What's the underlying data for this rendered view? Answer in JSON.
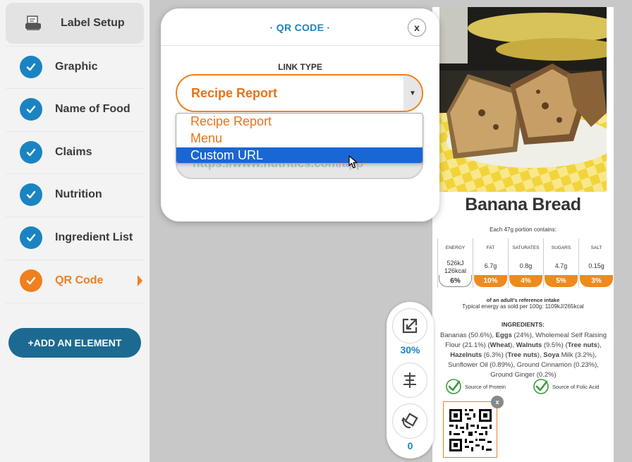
{
  "sidebar": {
    "items": [
      {
        "label": "Label Setup",
        "icon": "printer-icon"
      },
      {
        "label": "Graphic",
        "icon": "check-icon"
      },
      {
        "label": "Name of Food",
        "icon": "check-icon"
      },
      {
        "label": "Claims",
        "icon": "check-icon"
      },
      {
        "label": "Nutrition",
        "icon": "check-icon"
      },
      {
        "label": "Ingredient List",
        "icon": "check-icon"
      },
      {
        "label": "QR Code",
        "icon": "check-icon"
      }
    ],
    "add_button": "+ADD AN ELEMENT"
  },
  "modal": {
    "title": "· QR CODE ·",
    "close": "x",
    "link_type_label": "LINK TYPE",
    "selected_value": "Recipe Report",
    "url_value": "https://www.nutritics.com/app",
    "options": [
      "Recipe Report",
      "Menu",
      "Custom URL"
    ],
    "highlighted_option": "Custom URL"
  },
  "label": {
    "title": "Banana Bread",
    "portion": "Each 47g portion contains:",
    "nutrients": [
      {
        "name": "ENERGY",
        "value_line1": "526kJ",
        "value_line2": "126kcal",
        "percent": "6%"
      },
      {
        "name": "FAT",
        "value_line1": "6.7g",
        "value_line2": "",
        "percent": "10%"
      },
      {
        "name": "SATURATES",
        "value_line1": "0.8g",
        "value_line2": "",
        "percent": "4%"
      },
      {
        "name": "SUGARS",
        "value_line1": "4.7g",
        "value_line2": "",
        "percent": "5%"
      },
      {
        "name": "SALT",
        "value_line1": "0.15g",
        "value_line2": "",
        "percent": "3%"
      }
    ],
    "reference_intake": "of an adult's reference intake",
    "typical_energy": "Typical energy as sold per 100g: 1109kJ/265kcal",
    "ingredients_title": "INGREDIENTS:",
    "ingredients": [
      {
        "t": "Bananas (50.6%), ",
        "b": false
      },
      {
        "t": "Eggs",
        "b": true
      },
      {
        "t": " (24%), Wholemeal Self Raising Flour (21.1%) (",
        "b": false
      },
      {
        "t": "Wheat",
        "b": true
      },
      {
        "t": "), ",
        "b": false
      },
      {
        "t": "Walnuts",
        "b": true
      },
      {
        "t": " (9.5%) (",
        "b": false
      },
      {
        "t": "Tree nuts",
        "b": true
      },
      {
        "t": "), ",
        "b": false
      },
      {
        "t": "Hazelnuts",
        "b": true
      },
      {
        "t": " (6.3%) (",
        "b": false
      },
      {
        "t": "Tree nuts",
        "b": true
      },
      {
        "t": "), ",
        "b": false
      },
      {
        "t": "Soya",
        "b": true
      },
      {
        "t": " Milk (3.2%), Sunflower Oil (0.89%), Ground Cinnamon (0.23%), Ground Ginger (0.2%)",
        "b": false
      }
    ],
    "claims": [
      "Source of Protein",
      "Source of Folic Acid"
    ],
    "qr_remove": "x"
  },
  "tools": {
    "zoom": "30%",
    "rotation": "0"
  },
  "colors": {
    "accent_blue": "#1a84c3",
    "accent_orange": "#f07f1d",
    "button_dark_blue": "#1c6a92",
    "highlight_blue": "#1967d2"
  }
}
